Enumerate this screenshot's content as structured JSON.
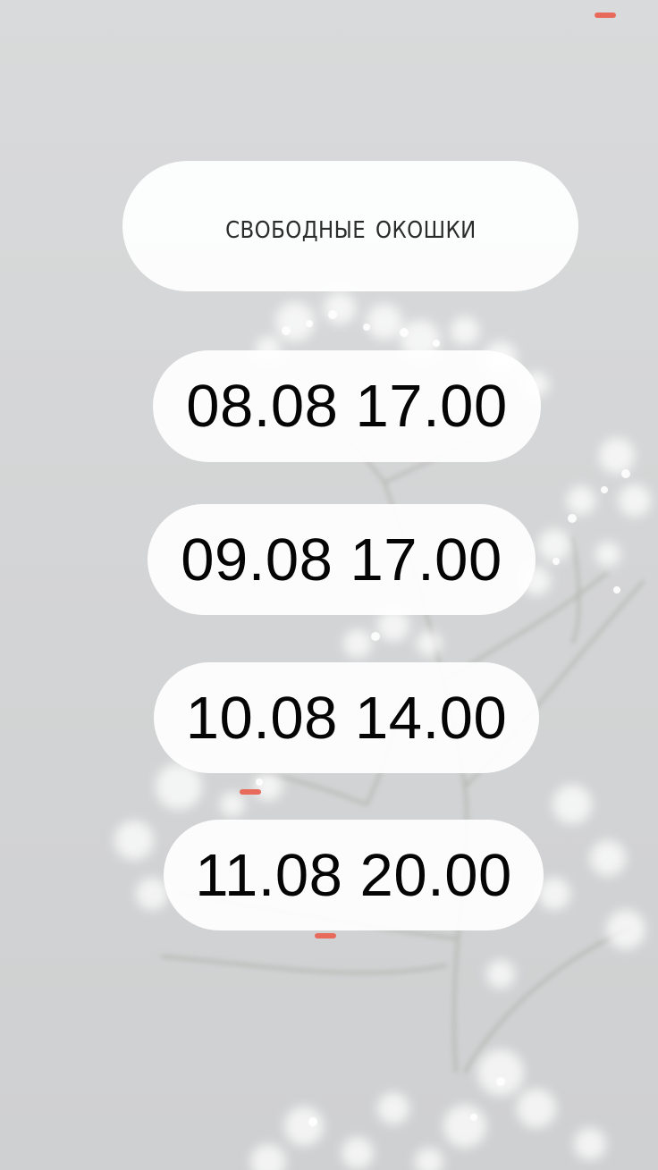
{
  "title": "свободные окошки",
  "slots": [
    {
      "label": "08.08 17.00"
    },
    {
      "label": "09.08 17.00"
    },
    {
      "label": "10.08 14.00"
    },
    {
      "label": "11.08 20.00"
    }
  ],
  "colors": {
    "background": "#d4d5d6",
    "pill": "#ffffff",
    "text": "#050505",
    "accent": "#e86a5a"
  }
}
